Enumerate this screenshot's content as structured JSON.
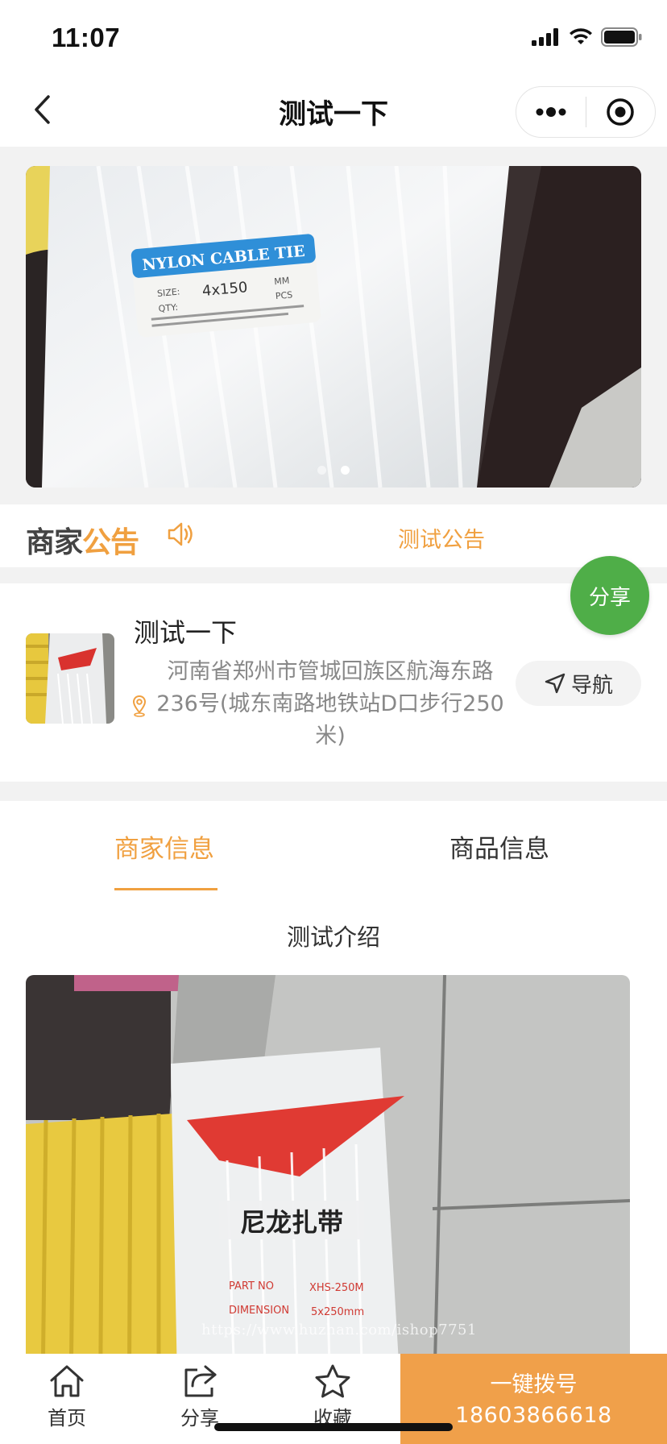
{
  "status_bar": {
    "time": "11:07"
  },
  "nav": {
    "title": "测试一下",
    "more_icon": "more-dots-icon",
    "close_icon": "target-circle-icon"
  },
  "banner": {
    "slides": 2,
    "active_slide": 2,
    "label_text": "NYLON CABLE TIE",
    "size_text": "4x150"
  },
  "notice": {
    "logo_part1": "商家",
    "logo_part2": "公告",
    "text": "测试公告"
  },
  "merchant": {
    "name": "测试一下",
    "address": "河南省郑州市管城回族区航海东路236号(城东南路地铁站D口步行250米)",
    "nav_button": "导航",
    "share_button": "分享"
  },
  "tabs": [
    {
      "label": "商家信息",
      "active": true
    },
    {
      "label": "商品信息",
      "active": false
    }
  ],
  "intro": "测试介绍",
  "photo": {
    "product_text": "尼龙扎带",
    "part_no": "XHS-250M",
    "dimension": "5x250mm"
  },
  "watermark": "https://www.huzhan.com/ishop7751",
  "bottom_bar": {
    "home": "首页",
    "share": "分享",
    "favorite": "收藏",
    "call_label": "一键拨号",
    "call_number": "18603866618"
  },
  "colors": {
    "accent": "#f0a040",
    "share_green": "#4fae48",
    "call_orange": "#f0a04a"
  }
}
